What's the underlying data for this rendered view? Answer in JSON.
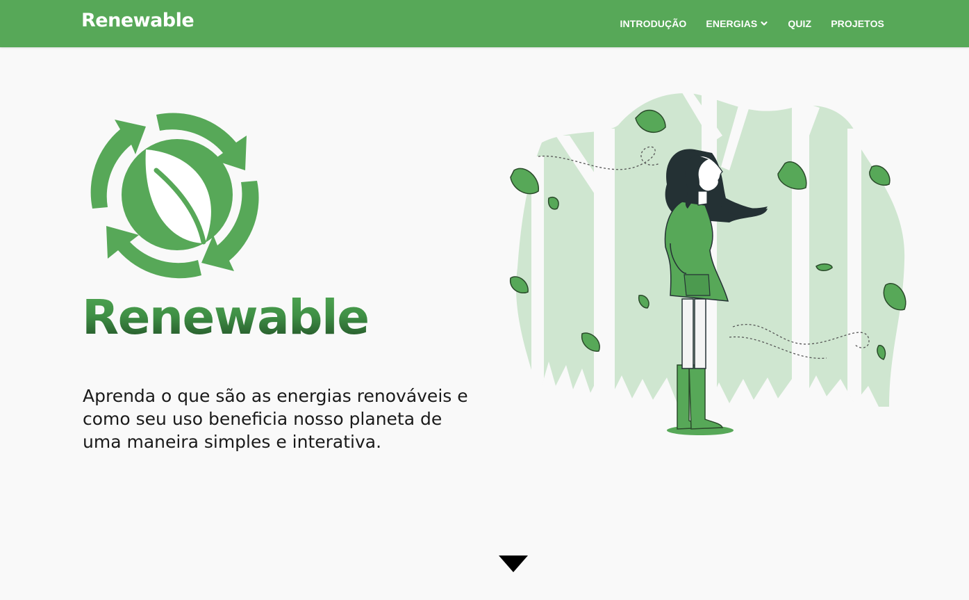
{
  "navbar": {
    "brand": "Renewable",
    "links": [
      {
        "label": "INTRODUÇÃO"
      },
      {
        "label": "ENERGIAS",
        "icon": "chevron-down-icon"
      },
      {
        "label": "QUIZ"
      },
      {
        "label": "PROJETOS"
      }
    ]
  },
  "hero": {
    "logo_icon": "recycle-leaf-icon",
    "title": "Renewable",
    "description": "Aprenda o que são as energias renováveis e como seu uso beneficia nosso planeta de uma maneira simples e interativa.",
    "illustration": "woman-in-forest-illustration"
  },
  "scroll_indicator": {
    "icon": "triangle-down-icon"
  },
  "colors": {
    "primary": "#57a858",
    "dark_green": "#1f4a24",
    "light_green": "#cfe6d0",
    "background": "#f9f9f9"
  }
}
